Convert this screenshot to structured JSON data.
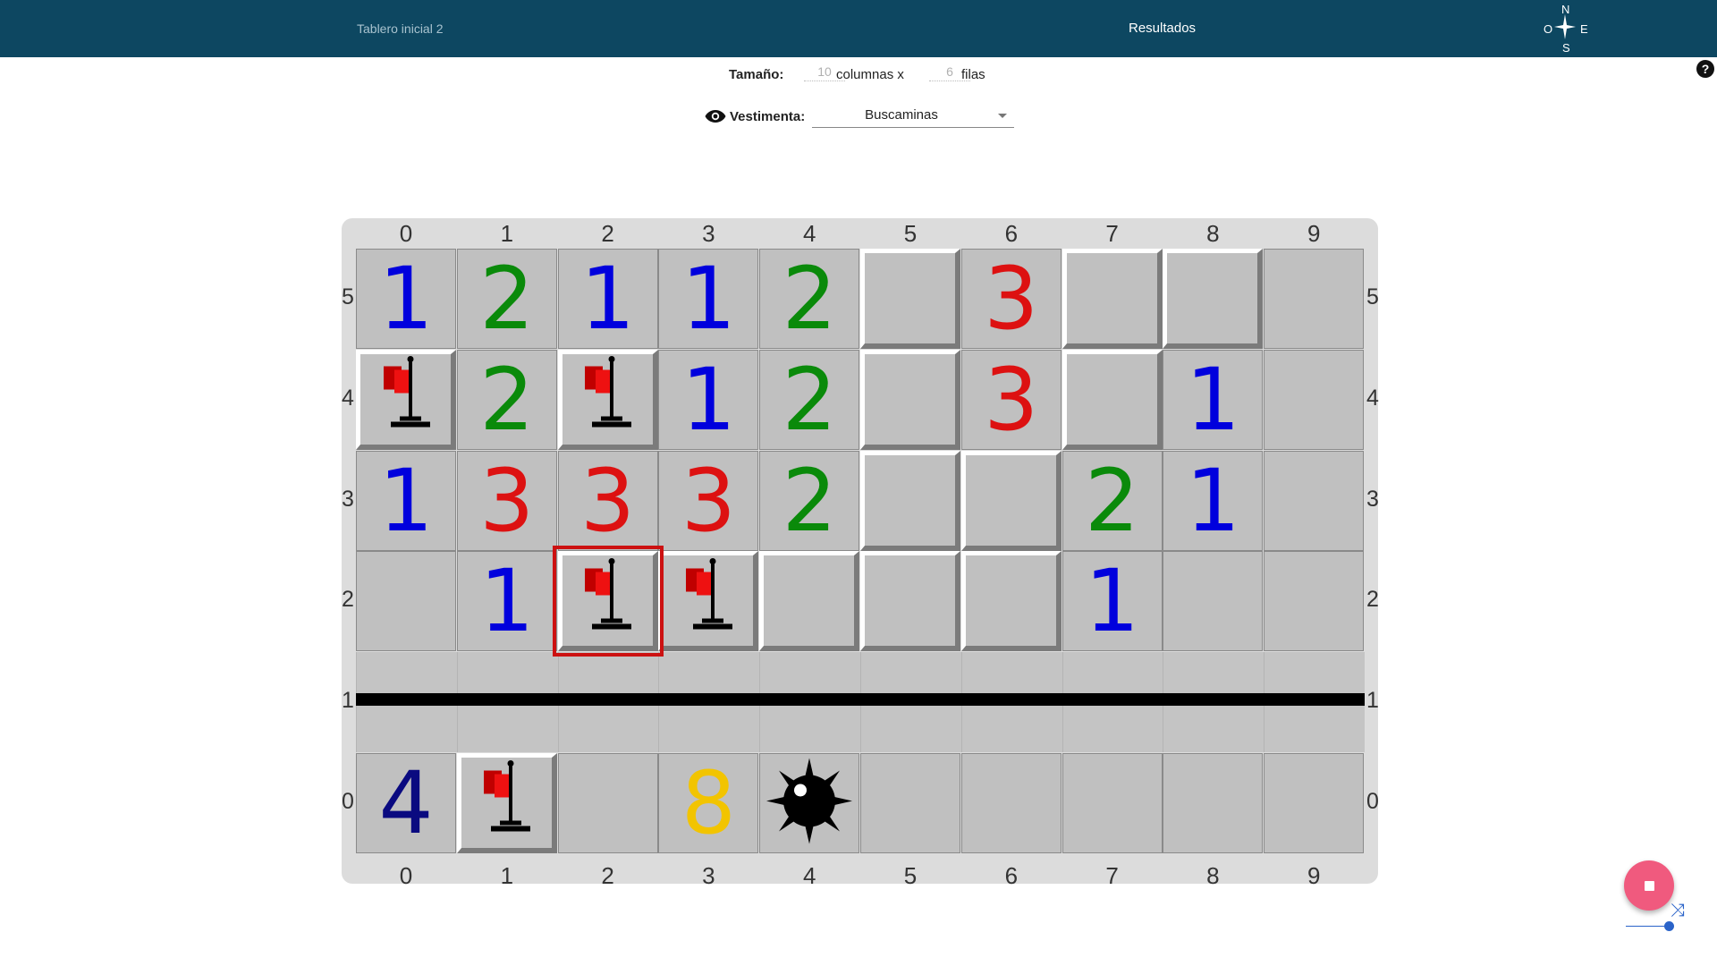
{
  "topbar": {
    "tab_initial": "Tablero inicial 2",
    "tab_results": "Resultados",
    "compass": {
      "n": "N",
      "s": "S",
      "o": "O",
      "e": "E"
    }
  },
  "size": {
    "label": "Tamaño:",
    "columns_value": "10",
    "columns_label": "columnas x",
    "rows_value": "6",
    "rows_label": "filas"
  },
  "outfit": {
    "label": "Vestimenta:",
    "selected": "Buscaminas"
  },
  "help_icon": "?",
  "board": {
    "columns": [
      "0",
      "1",
      "2",
      "3",
      "4",
      "5",
      "6",
      "7",
      "8",
      "9"
    ],
    "row_labels": [
      "5",
      "4",
      "3",
      "2",
      "1",
      "0"
    ],
    "rows": [
      {
        "label": "5",
        "cells": [
          {
            "t": "num",
            "v": "1",
            "c": "blue"
          },
          {
            "t": "num",
            "v": "2",
            "c": "green"
          },
          {
            "t": "num",
            "v": "1",
            "c": "blue"
          },
          {
            "t": "num",
            "v": "1",
            "c": "blue"
          },
          {
            "t": "num",
            "v": "2",
            "c": "green"
          },
          {
            "t": "covered"
          },
          {
            "t": "num",
            "v": "3",
            "c": "red"
          },
          {
            "t": "covered"
          },
          {
            "t": "covered"
          },
          {
            "t": "empty"
          }
        ]
      },
      {
        "label": "4",
        "cells": [
          {
            "t": "flag"
          },
          {
            "t": "num",
            "v": "2",
            "c": "green"
          },
          {
            "t": "flag"
          },
          {
            "t": "num",
            "v": "1",
            "c": "blue"
          },
          {
            "t": "num",
            "v": "2",
            "c": "green"
          },
          {
            "t": "covered"
          },
          {
            "t": "num",
            "v": "3",
            "c": "red"
          },
          {
            "t": "covered"
          },
          {
            "t": "num",
            "v": "1",
            "c": "blue"
          },
          {
            "t": "empty"
          }
        ]
      },
      {
        "label": "3",
        "cells": [
          {
            "t": "num",
            "v": "1",
            "c": "blue"
          },
          {
            "t": "num",
            "v": "3",
            "c": "red"
          },
          {
            "t": "num",
            "v": "3",
            "c": "red"
          },
          {
            "t": "num",
            "v": "3",
            "c": "red"
          },
          {
            "t": "num",
            "v": "2",
            "c": "green"
          },
          {
            "t": "covered"
          },
          {
            "t": "covered"
          },
          {
            "t": "num",
            "v": "2",
            "c": "green"
          },
          {
            "t": "num",
            "v": "1",
            "c": "blue"
          },
          {
            "t": "empty"
          }
        ]
      },
      {
        "label": "2",
        "cells": [
          {
            "t": "empty"
          },
          {
            "t": "num",
            "v": "1",
            "c": "blue"
          },
          {
            "t": "flag",
            "selected": true
          },
          {
            "t": "flag"
          },
          {
            "t": "covered"
          },
          {
            "t": "covered"
          },
          {
            "t": "covered"
          },
          {
            "t": "num",
            "v": "1",
            "c": "blue"
          },
          {
            "t": "empty"
          },
          {
            "t": "empty"
          }
        ]
      },
      {
        "label": "1",
        "wall": true,
        "cells": []
      },
      {
        "label": "0",
        "cells": [
          {
            "t": "num",
            "v": "4",
            "c": "navy"
          },
          {
            "t": "flag"
          },
          {
            "t": "empty"
          },
          {
            "t": "num",
            "v": "8",
            "c": "yellow"
          },
          {
            "t": "mine"
          },
          {
            "t": "empty"
          },
          {
            "t": "empty"
          },
          {
            "t": "empty"
          },
          {
            "t": "empty"
          },
          {
            "t": "empty"
          }
        ]
      }
    ]
  },
  "colors": {
    "topbar": "#0d4761",
    "blue": "#0000dd",
    "green": "#0a8a0a",
    "red": "#dd1111",
    "navy": "#0a0a80",
    "yellow": "#f2c400",
    "selected_outline": "#cc1111",
    "fab": "#f05a7e"
  }
}
